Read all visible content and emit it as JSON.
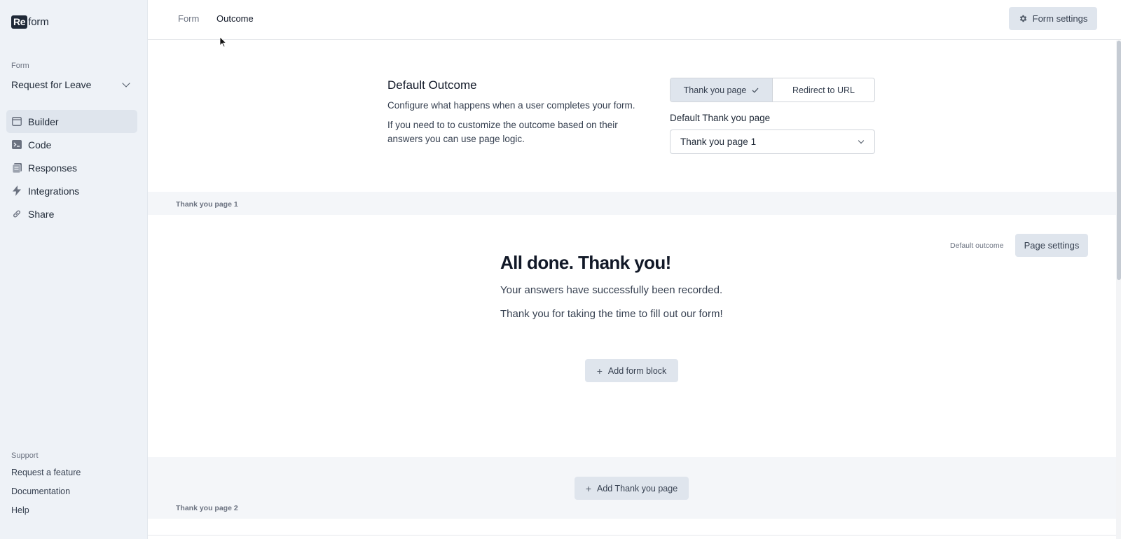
{
  "app": {
    "logo_box": "Re",
    "logo_text": "form"
  },
  "sidebar": {
    "form_label": "Form",
    "form_selected": "Request for Leave",
    "items": [
      {
        "label": "Builder",
        "icon": "builder-icon",
        "active": true
      },
      {
        "label": "Code",
        "icon": "code-icon",
        "active": false
      },
      {
        "label": "Responses",
        "icon": "responses-icon",
        "active": false
      },
      {
        "label": "Integrations",
        "icon": "bolt-icon",
        "active": false
      },
      {
        "label": "Share",
        "icon": "link-icon",
        "active": false
      }
    ],
    "support_label": "Support",
    "support_links": [
      "Request a feature",
      "Documentation",
      "Help"
    ]
  },
  "topbar": {
    "tabs": [
      {
        "label": "Form",
        "active": false
      },
      {
        "label": "Outcome",
        "active": true
      }
    ],
    "settings_button": "Form settings"
  },
  "default_outcome": {
    "title": "Default Outcome",
    "description": "Configure what happens when a user completes your form.",
    "description2": "If you need to to customize the outcome based on their answers you can use page logic.",
    "options": [
      {
        "label": "Thank you page",
        "selected": true
      },
      {
        "label": "Redirect to URL",
        "selected": false
      }
    ],
    "default_page_label": "Default Thank you page",
    "default_page_value": "Thank you page 1"
  },
  "thank_you_page_1": {
    "label": "Thank you page 1",
    "tag": "Default outcome",
    "settings_button": "Page settings",
    "heading": "All done. Thank you!",
    "paragraph1": "Your answers have successfully been recorded.",
    "paragraph2": "Thank you for taking the time to fill out our form!",
    "add_block_button": "Add form block"
  },
  "thank_you_page_2": {
    "add_button": "Add Thank you page",
    "label": "Thank you page 2"
  },
  "colors": {
    "sidebar_bg": "#eef2f7",
    "button_bg": "#dfe5ed",
    "band_bg": "#f4f6f9",
    "text_primary": "#111827"
  }
}
